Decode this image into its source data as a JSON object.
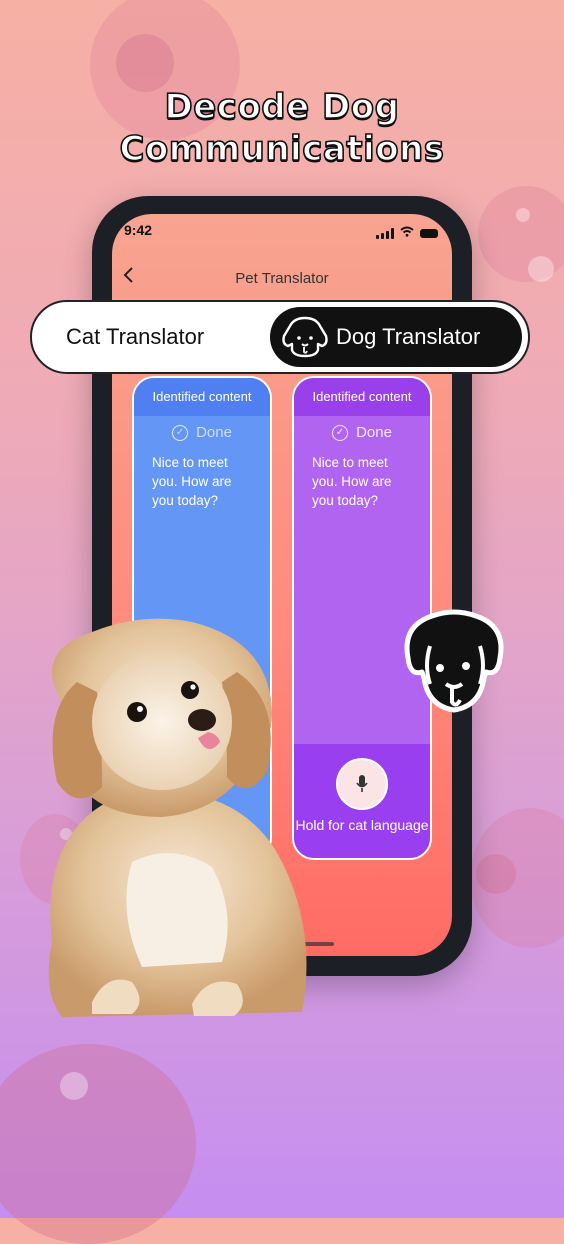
{
  "headline": {
    "line1": "Decode Dog",
    "line2": "Communications"
  },
  "phone": {
    "status_time": "9:42",
    "screen_title": "Pet Translator",
    "back_label": "<"
  },
  "toggle": {
    "cat_label": "Cat Translator",
    "dog_label": "Dog Translator",
    "selected": "Dog Translator"
  },
  "cards": {
    "left": {
      "header": "Identified content",
      "status": "Done",
      "message": "Nice to meet you. How are you today?"
    },
    "right": {
      "header": "Identified content",
      "status": "Done",
      "message": "Nice to meet you. How are you today?",
      "action_label": "Hold for cat language"
    }
  },
  "icons": [
    "chevron-left-icon",
    "signal-icon",
    "wifi-icon",
    "battery-icon",
    "dog-face-icon",
    "check-circle-icon",
    "microphone-icon"
  ],
  "colors": {
    "accent_blue": "#6496f5",
    "accent_purple": "#b064f0",
    "toggle_active": "#111111"
  }
}
